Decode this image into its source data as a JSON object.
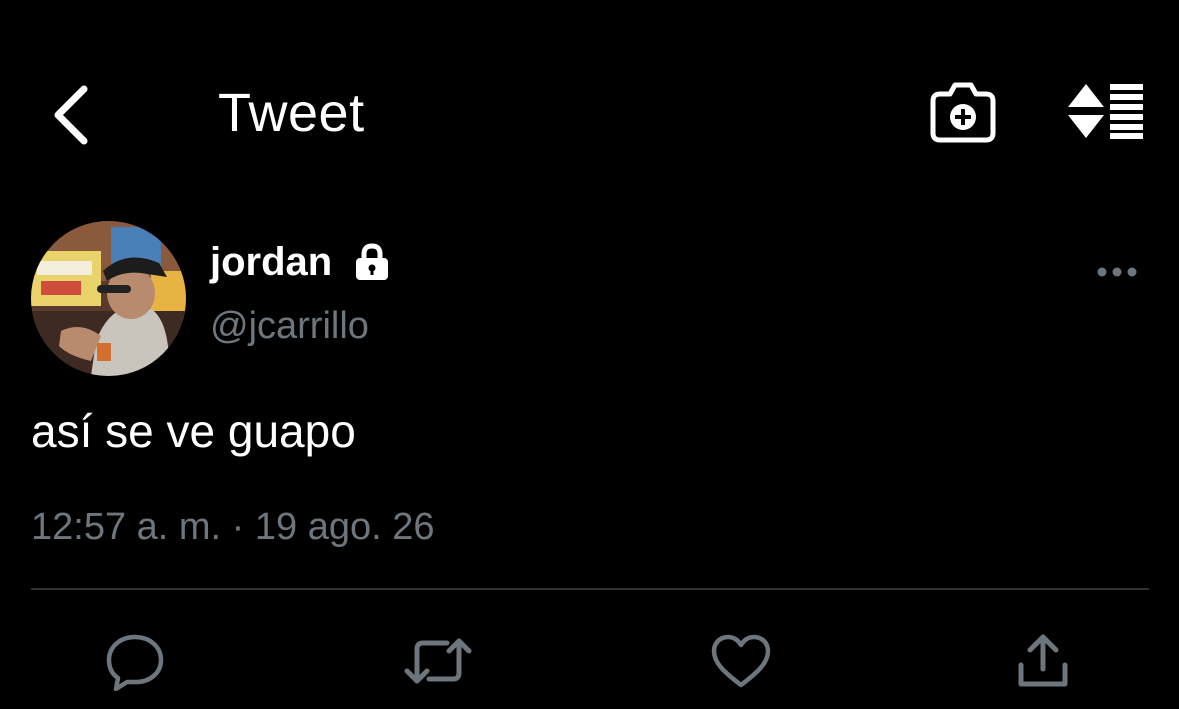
{
  "header": {
    "title": "Tweet",
    "icons": {
      "back": "chevron-left-icon",
      "camera": "camera-plus-icon",
      "sort": "sort-list-icon"
    }
  },
  "tweet": {
    "author": {
      "display_name": "jordan",
      "handle": "@jcarrillo",
      "protected": true
    },
    "text": "así se ve guapo",
    "timestamp": "12:57 a. m. · 19 ago. 26"
  },
  "actions": [
    "reply-icon",
    "retweet-icon",
    "like-icon",
    "share-icon"
  ],
  "colors": {
    "background": "#000000",
    "text_primary": "#ffffff",
    "text_secondary": "#6e767d",
    "divider": "#2f3336"
  }
}
